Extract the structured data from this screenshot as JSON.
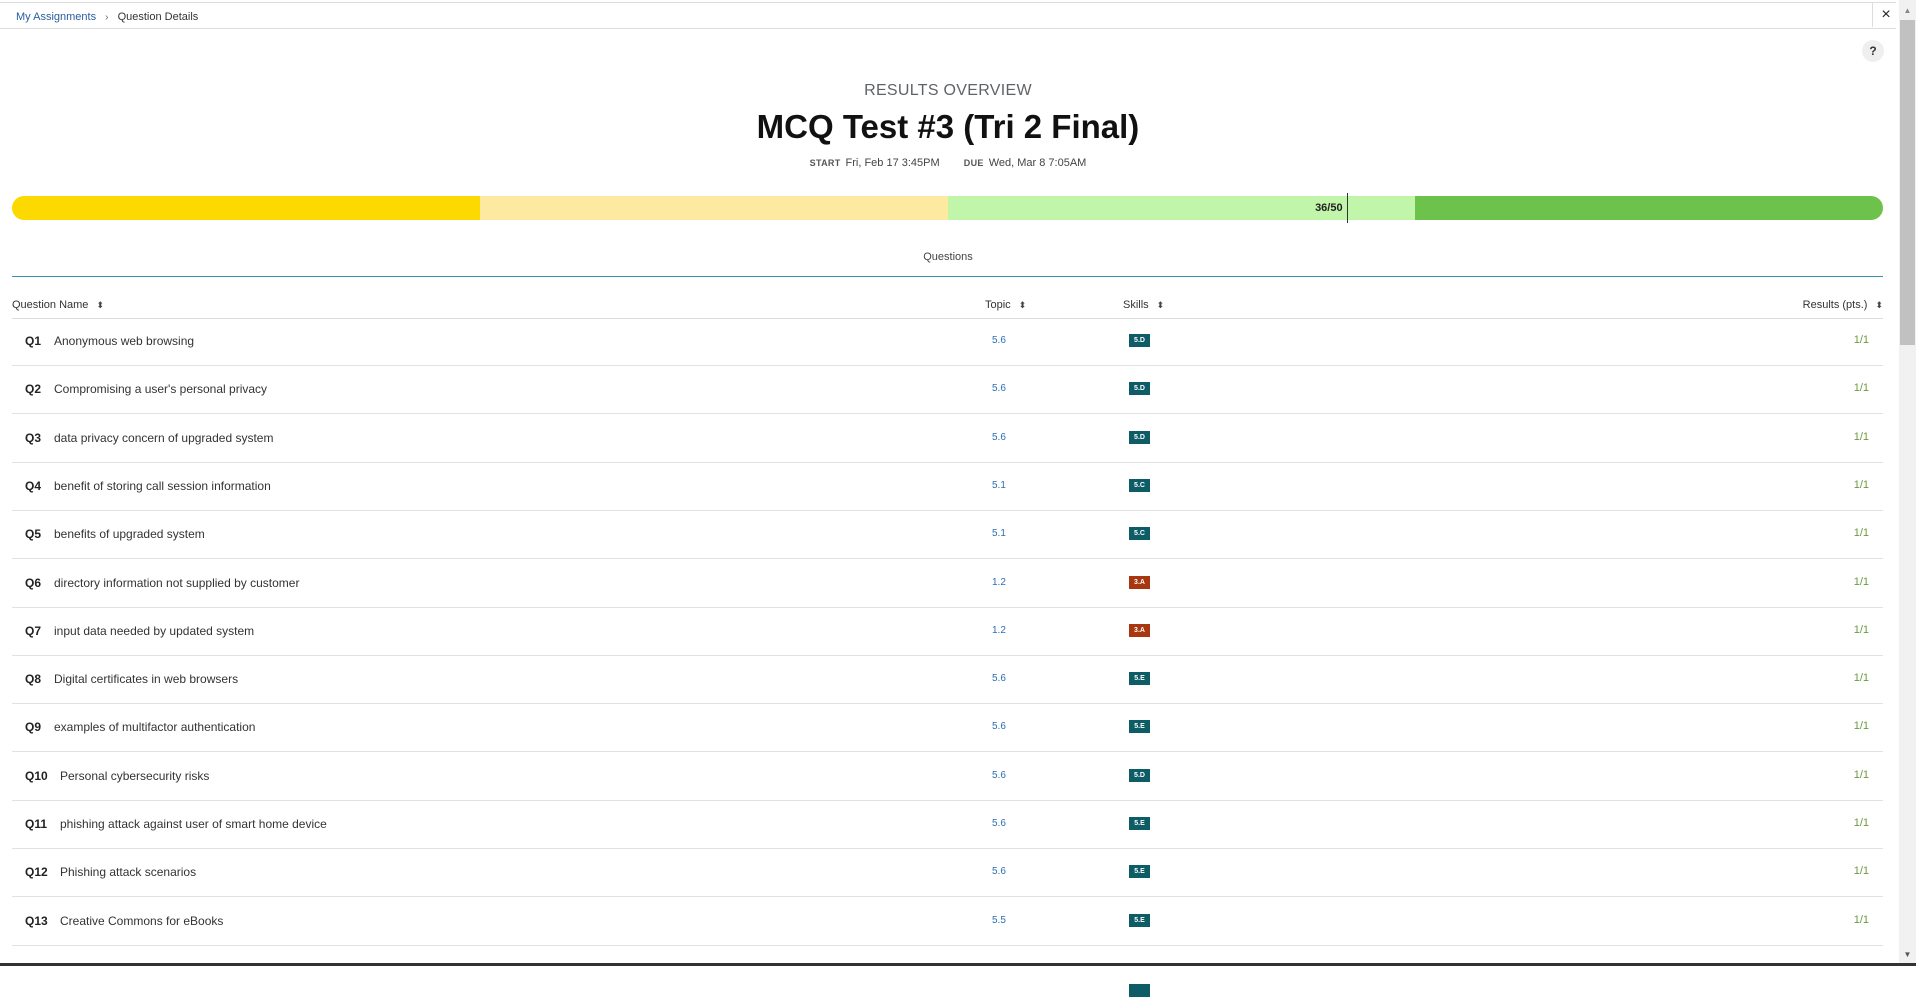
{
  "breadcrumb": {
    "parent": "My Assignments",
    "separator": "›",
    "current": "Question Details"
  },
  "window": {
    "close_icon": "×",
    "help_label": "?"
  },
  "overview": {
    "label": "RESULTS OVERVIEW",
    "title": "MCQ Test #3 (Tri 2 Final)",
    "start_key": "START",
    "start_value": "Fri, Feb 17 3:45PM",
    "due_key": "DUE",
    "due_value": "Wed, Mar 8 7:05AM"
  },
  "score_bar": {
    "score_label": "36/50",
    "score": 36,
    "max": 50,
    "segment_colors": [
      "#fcd900",
      "#fdeaa0",
      "#c1f5aa",
      "#6cc24a"
    ]
  },
  "tab": {
    "label": "Questions"
  },
  "table": {
    "columns": {
      "name": "Question Name",
      "topic": "Topic",
      "skills": "Skills",
      "results": "Results (pts.)"
    },
    "sort_icon": "⬍",
    "skill_colors": {
      "teal": "#0e5c66",
      "rust": "#a8360f"
    },
    "rows": [
      {
        "num": "Q1",
        "name": "Anonymous web browsing",
        "topic": "5.6",
        "skill": "5.D",
        "skill_color": "teal",
        "result": "1/1"
      },
      {
        "num": "Q2",
        "name": "Compromising a user's personal privacy",
        "topic": "5.6",
        "skill": "5.D",
        "skill_color": "teal",
        "result": "1/1"
      },
      {
        "num": "Q3",
        "name": "data privacy concern of upgraded system",
        "topic": "5.6",
        "skill": "5.D",
        "skill_color": "teal",
        "result": "1/1"
      },
      {
        "num": "Q4",
        "name": "benefit of storing call session information",
        "topic": "5.1",
        "skill": "5.C",
        "skill_color": "teal",
        "result": "1/1"
      },
      {
        "num": "Q5",
        "name": "benefits of upgraded system",
        "topic": "5.1",
        "skill": "5.C",
        "skill_color": "teal",
        "result": "1/1"
      },
      {
        "num": "Q6",
        "name": "directory information not supplied by customer",
        "topic": "1.2",
        "skill": "3.A",
        "skill_color": "rust",
        "result": "1/1"
      },
      {
        "num": "Q7",
        "name": "input data needed by updated system",
        "topic": "1.2",
        "skill": "3.A",
        "skill_color": "rust",
        "result": "1/1"
      },
      {
        "num": "Q8",
        "name": "Digital certificates in web browsers",
        "topic": "5.6",
        "skill": "5.E",
        "skill_color": "teal",
        "result": "1/1"
      },
      {
        "num": "Q9",
        "name": "examples of multifactor authentication",
        "topic": "5.6",
        "skill": "5.E",
        "skill_color": "teal",
        "result": "1/1"
      },
      {
        "num": "Q10",
        "name": "Personal cybersecurity risks",
        "topic": "5.6",
        "skill": "5.D",
        "skill_color": "teal",
        "result": "1/1"
      },
      {
        "num": "Q11",
        "name": "phishing attack against user of smart home device",
        "topic": "5.6",
        "skill": "5.E",
        "skill_color": "teal",
        "result": "1/1"
      },
      {
        "num": "Q12",
        "name": "Phishing attack scenarios",
        "topic": "5.6",
        "skill": "5.E",
        "skill_color": "teal",
        "result": "1/1"
      },
      {
        "num": "Q13",
        "name": "Creative Commons for eBooks",
        "topic": "5.5",
        "skill": "5.E",
        "skill_color": "teal",
        "result": "1/1"
      },
      {
        "num": "",
        "name": "",
        "topic": "",
        "skill": "",
        "skill_color": "teal",
        "result": ""
      }
    ]
  }
}
